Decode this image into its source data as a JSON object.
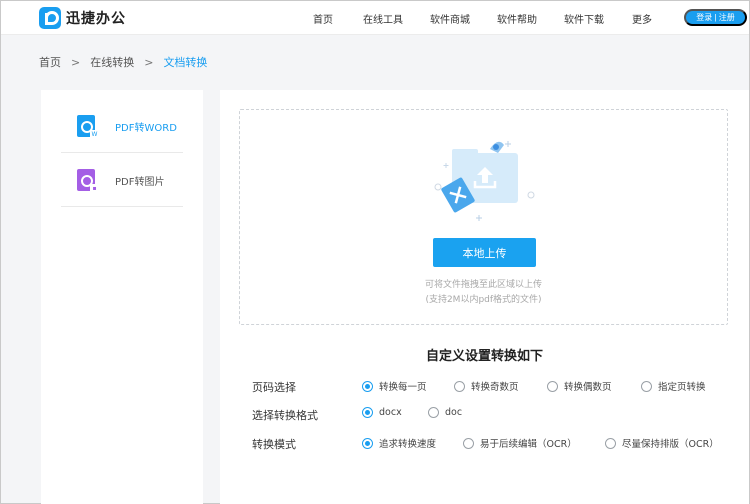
{
  "header": {
    "logo_text": "迅捷办公",
    "nav": [
      "首页",
      "在线工具",
      "软件商城",
      "软件帮助",
      "软件下载",
      "更多"
    ],
    "login_label": "登录 | 注册"
  },
  "breadcrumb": {
    "items": [
      "首页",
      "在线转换",
      "文档转换"
    ],
    "separator": ">"
  },
  "sidebar": {
    "items": [
      {
        "label": "PDF转WORD",
        "icon": "pdf-to-word-icon",
        "active": true
      },
      {
        "label": "PDF转图片",
        "icon": "pdf-to-image-icon",
        "active": false
      }
    ]
  },
  "upload": {
    "button_label": "本地上传",
    "hint_line1": "可将文件拖拽至此区域以上传",
    "hint_line2": "(支持2M以内pdf格式的文件)"
  },
  "settings": {
    "title": "自定义设置转换如下",
    "rows": [
      {
        "label": "页码选择",
        "options": [
          "转换每一页",
          "转换奇数页",
          "转换偶数页",
          "指定页转换"
        ],
        "selected": 0
      },
      {
        "label": "选择转换格式",
        "options": [
          "docx",
          "doc"
        ],
        "selected": 0
      },
      {
        "label": "转换模式",
        "options": [
          "追求转换速度",
          "易于后续编辑（OCR）",
          "尽量保持排版（OCR）"
        ],
        "selected": 0
      }
    ]
  },
  "colors": {
    "accent": "#1a9ef0",
    "word_icon": "#1a9ef0",
    "image_icon": "#a45ee5"
  }
}
